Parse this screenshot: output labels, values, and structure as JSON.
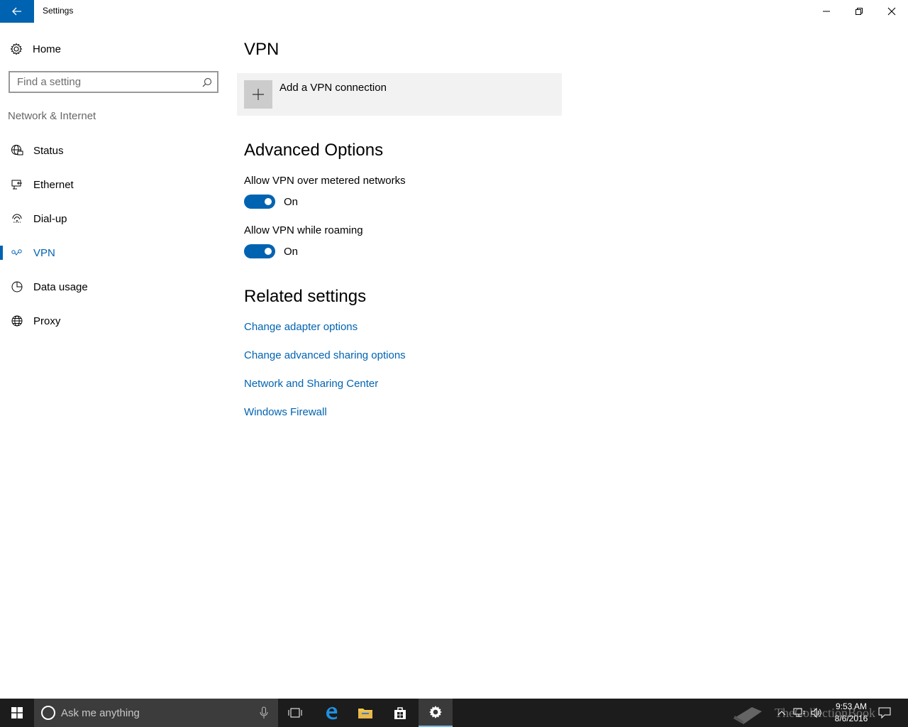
{
  "window": {
    "title": "Settings"
  },
  "sidebar": {
    "home_label": "Home",
    "search_placeholder": "Find a setting",
    "section_title": "Network & Internet",
    "items": [
      {
        "label": "Status",
        "icon": "globe-monitor-icon"
      },
      {
        "label": "Ethernet",
        "icon": "ethernet-icon"
      },
      {
        "label": "Dial-up",
        "icon": "dial-up-icon"
      },
      {
        "label": "VPN",
        "icon": "vpn-icon",
        "active": true
      },
      {
        "label": "Data usage",
        "icon": "data-usage-icon"
      },
      {
        "label": "Proxy",
        "icon": "globe-icon"
      }
    ]
  },
  "main": {
    "title": "VPN",
    "add_vpn_label": "Add a VPN connection",
    "advanced_title": "Advanced Options",
    "options": [
      {
        "label": "Allow VPN over metered networks",
        "state": "On"
      },
      {
        "label": "Allow VPN while roaming",
        "state": "On"
      }
    ],
    "related_title": "Related settings",
    "links": [
      "Change adapter options",
      "Change advanced sharing options",
      "Network and Sharing Center",
      "Windows Firewall"
    ]
  },
  "taskbar": {
    "search_placeholder": "Ask me anything",
    "time": "9:53 AM",
    "date": "8/6/2016",
    "watermark": "TheCollectionBook"
  },
  "colors": {
    "accent": "#0063b1",
    "taskbar": "#1c1c1c",
    "tile": "#f2f2f2"
  }
}
